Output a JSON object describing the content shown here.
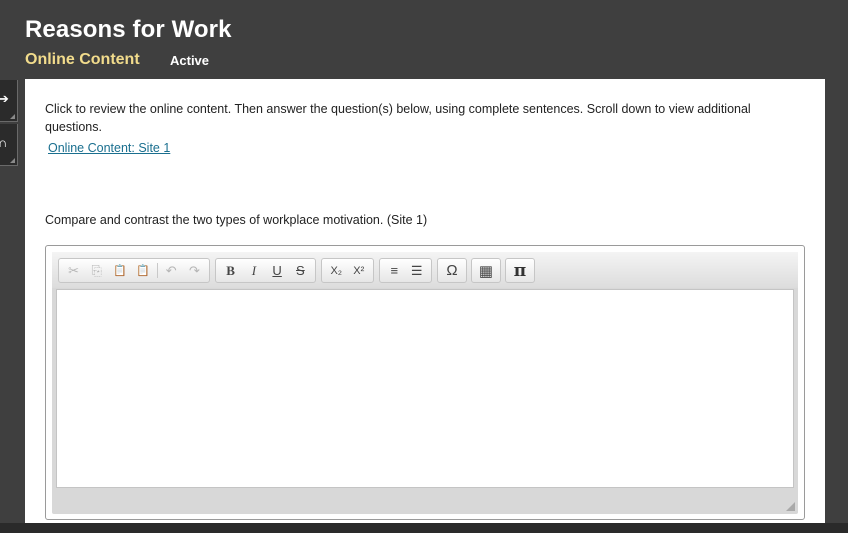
{
  "header": {
    "title": "Reasons for Work",
    "subtitle": "Online Content",
    "status": "Active"
  },
  "content": {
    "instructions": "Click to review the online content. Then answer the question(s) below, using complete sentences. Scroll down to view additional questions.",
    "link_label": "Online Content: Site 1",
    "question": "Compare and contrast the two types of workplace motivation. (Site 1)"
  },
  "editor": {
    "buttons": {
      "cut": "✂",
      "copy": "⎘",
      "paste": "📋",
      "paste_text": "📋",
      "undo": "↶",
      "redo": "↷",
      "bold": "B",
      "italic": "I",
      "underline": "U",
      "strike": "S",
      "subscript": "X₂",
      "superscript": "X²",
      "numbered_list": "≡",
      "bullet_list": "☰",
      "special_char": "Ω",
      "table": "▦",
      "math": "π"
    },
    "value": ""
  }
}
